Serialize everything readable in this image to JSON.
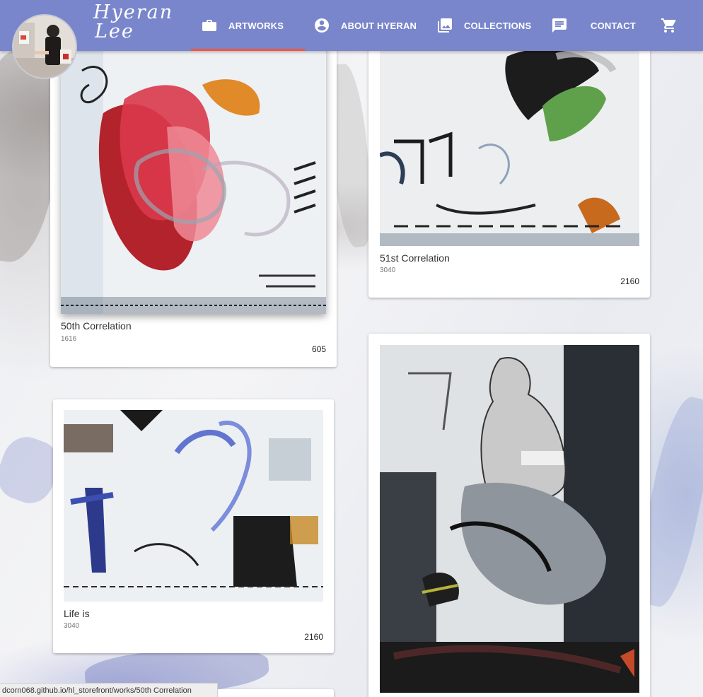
{
  "brand": {
    "name_line1": "Hyeran",
    "name_line2": "Lee"
  },
  "nav": {
    "items": [
      {
        "label": "ARTWORKS",
        "icon": "briefcase-icon",
        "active": true
      },
      {
        "label": "ABOUT HYERAN",
        "icon": "account-circle-icon",
        "active": false
      },
      {
        "label": "COLLECTIONS",
        "icon": "photo-library-icon",
        "active": false
      },
      {
        "label": "CONTACT",
        "icon": "chat-icon",
        "active": false
      }
    ],
    "cart_icon": "shopping-cart-icon",
    "accent_color": "#7986cb",
    "indicator_color": "#f05545"
  },
  "artworks": [
    {
      "title": "50th Correlation",
      "subtitle": "1616",
      "number": "605"
    },
    {
      "title": "51st Correlation",
      "subtitle": "3040",
      "number": "2160"
    },
    {
      "title": "Life is",
      "subtitle": "3040",
      "number": "2160"
    },
    {
      "title": "",
      "subtitle": "",
      "number": ""
    }
  ],
  "status_bar": {
    "url": "dcorn068.github.io/hl_storefront/works/50th Correlation"
  }
}
